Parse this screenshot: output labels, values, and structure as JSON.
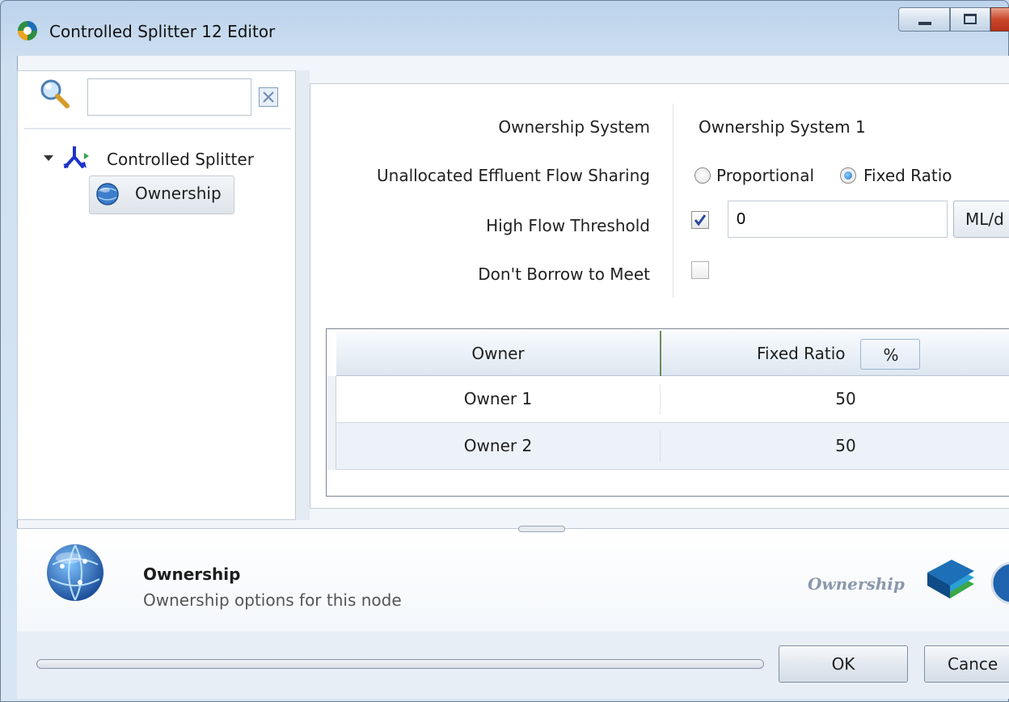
{
  "window": {
    "title": "Controlled Splitter 12 Editor"
  },
  "search": {
    "placeholder": ""
  },
  "tree": {
    "root_label": "Controlled Splitter",
    "child_label": "Ownership"
  },
  "form": {
    "ownership_system_label": "Ownership System",
    "ownership_system_value": "Ownership System 1",
    "sharing_label": "Unallocated Effluent Flow Sharing",
    "sharing_options": [
      "Proportional",
      "Fixed Ratio"
    ],
    "sharing_selected": "Fixed Ratio",
    "high_flow_label": "High Flow Threshold",
    "high_flow_checked": true,
    "high_flow_value": "0",
    "high_flow_unit": "ML/d",
    "borrow_label": "Don't Borrow to Meet",
    "borrow_checked": false
  },
  "grid": {
    "col_owner": "Owner",
    "col_ratio": "Fixed Ratio",
    "ratio_unit": "%",
    "rows": [
      {
        "owner": "Owner 1",
        "ratio": "50"
      },
      {
        "owner": "Owner 2",
        "ratio": "50"
      }
    ]
  },
  "info": {
    "title": "Ownership",
    "description": "Ownership options for this node",
    "breadcrumb": "Ownership"
  },
  "buttons": {
    "ok": "OK",
    "cancel": "Cance"
  }
}
